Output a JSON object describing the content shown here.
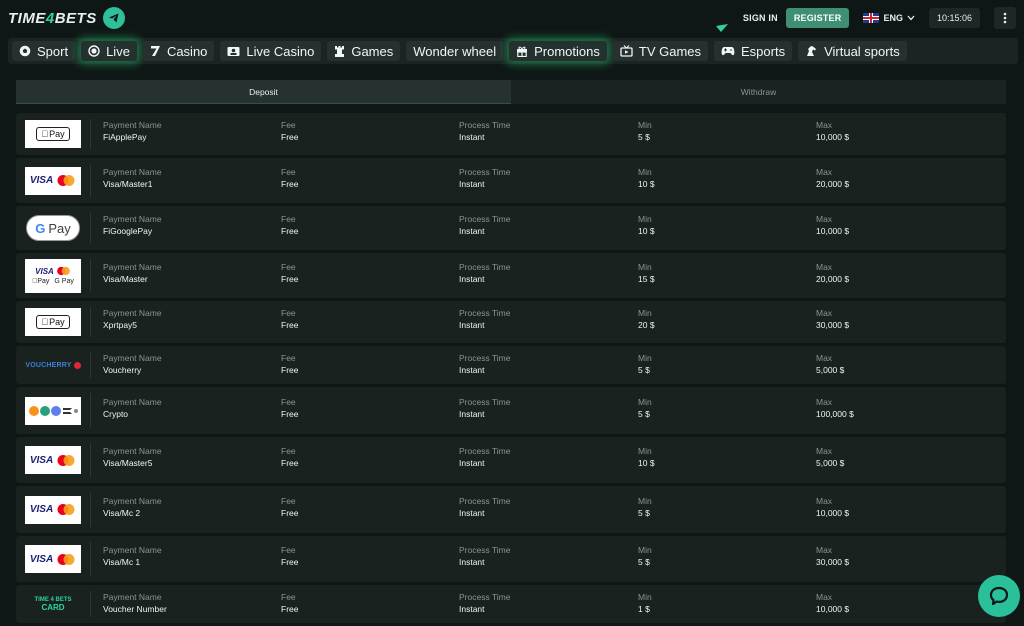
{
  "header": {
    "logo_prefix": "TIME",
    "logo_digit": "4",
    "logo_suffix": "BETS",
    "sign_in": "SIGN IN",
    "register": "REGISTER",
    "language": "ENG",
    "clock": "10:15:06",
    "telegram_icon": "paper-plane-icon",
    "menu_icon": "kebab-icon"
  },
  "nav": {
    "items": [
      {
        "label": "Sport",
        "icon": "soccer-ball-icon"
      },
      {
        "label": "Live",
        "icon": "live-dot-icon"
      },
      {
        "label": "Casino",
        "icon": "seven-icon"
      },
      {
        "label": "Live Casino",
        "icon": "dealer-icon"
      },
      {
        "label": "Games",
        "icon": "chess-rook-icon"
      },
      {
        "label": "Wonder wheel",
        "icon": ""
      },
      {
        "label": "Promotions",
        "icon": "gift-icon"
      },
      {
        "label": "TV Games",
        "icon": "tv-icon"
      },
      {
        "label": "Esports",
        "icon": "gamepad-icon"
      },
      {
        "label": "Virtual sports",
        "icon": "horse-icon"
      }
    ]
  },
  "tabs": {
    "deposit": "Deposit",
    "withdraw": "Withdraw"
  },
  "columns": {
    "name": "Payment Name",
    "fee": "Fee",
    "time": "Process Time",
    "min": "Min",
    "max": "Max"
  },
  "methods": [
    {
      "name": "FiApplePay",
      "fee": "Free",
      "time": "Instant",
      "min": "5 $",
      "max": "10,000 $",
      "logo": "Pay"
    },
    {
      "name": "Visa/Master1",
      "fee": "Free",
      "time": "Instant",
      "min": "10 $",
      "max": "20,000 $",
      "logo": "VISA"
    },
    {
      "name": "FiGooglePay",
      "fee": "Free",
      "time": "Instant",
      "min": "10 $",
      "max": "10,000 $",
      "logo": "Pay"
    },
    {
      "name": "Visa/Master",
      "fee": "Free",
      "time": "Instant",
      "min": "15 $",
      "max": "20,000 $",
      "logo": "VISA",
      "logo_line2a": "Pay",
      "logo_line2b": "G Pay"
    },
    {
      "name": "Xprtpay5",
      "fee": "Free",
      "time": "Instant",
      "min": "20 $",
      "max": "30,000 $",
      "logo": "Pay"
    },
    {
      "name": "Voucherry",
      "fee": "Free",
      "time": "Instant",
      "min": "5 $",
      "max": "5,000 $",
      "logo": "VOUCHERRY"
    },
    {
      "name": "Crypto",
      "fee": "Free",
      "time": "Instant",
      "min": "5 $",
      "max": "100,000 $",
      "logo": ""
    },
    {
      "name": "Visa/Master5",
      "fee": "Free",
      "time": "Instant",
      "min": "10 $",
      "max": "5,000 $",
      "logo": "VISA"
    },
    {
      "name": "Visa/Mc 2",
      "fee": "Free",
      "time": "Instant",
      "min": "5 $",
      "max": "10,000 $",
      "logo": "VISA"
    },
    {
      "name": "Visa/Mc 1",
      "fee": "Free",
      "time": "Instant",
      "min": "5 $",
      "max": "30,000 $",
      "logo": "VISA"
    },
    {
      "name": "Voucher Number",
      "fee": "Free",
      "time": "Instant",
      "min": "1 $",
      "max": "10,000 $",
      "logo": "TIME 4 BETS",
      "logo_line2a": "CARD"
    }
  ],
  "colors": {
    "accent": "#2fd3a3",
    "glow": "#26dd82",
    "background": "#0f1716"
  }
}
